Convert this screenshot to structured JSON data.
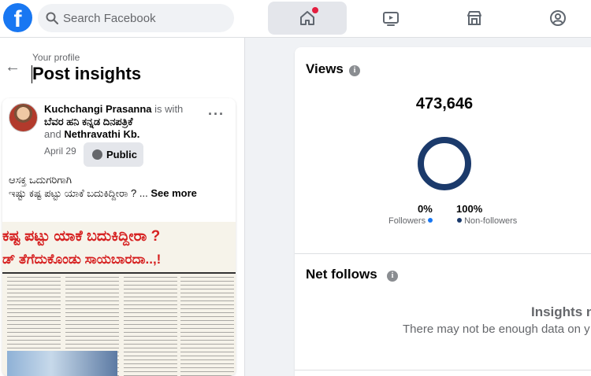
{
  "topbar": {
    "logo_letter": "f",
    "search": {
      "placeholder": "Search Facebook"
    }
  },
  "nav": {
    "tabs": [
      {
        "name": "home",
        "active": true,
        "has_notification": true
      },
      {
        "name": "watch",
        "active": false
      },
      {
        "name": "marketplace",
        "active": false
      },
      {
        "name": "groups",
        "active": false
      }
    ]
  },
  "left": {
    "subtitle": "Your profile",
    "title": "Post insights",
    "post": {
      "author": "Kuchchangi Prasanna",
      "with_text": "is with",
      "tagged1": "ಬೆವರ ಹನಿ ಕನ್ನಡ ದಿನಪತ್ರಿಕೆ",
      "and_text": "and",
      "tagged2": "Nethravathi Kb.",
      "date": "April 29",
      "audience": "Public",
      "line1": "ಆಸಕ್ತ ಒದುಗರಿಗಾಗಿ",
      "line2": "ಇಷ್ಟು ಕಷ್ಟ ಪಟ್ಟು ಯಾಕೆ ಬದುಕಿದ್ದೀರಾ ? ...",
      "see_more": "See more",
      "image_headline1": "ಕಷ್ಟ ಪಟ್ಟು ಯಾಕೆ ಬದುಕಿದ್ದೀರಾ ?",
      "image_headline2": "ಡ್ ತೆಗೆದುಕೊಂಡು ಸಾಯಬಾರದಾ..,!"
    }
  },
  "right": {
    "views": {
      "title": "Views",
      "count": "473,646",
      "followers_pct": "0%",
      "nonfollowers_pct": "100%",
      "followers_label": "Followers",
      "nonfollowers_label": "Non-followers",
      "followers_color": "#1877f2",
      "nonfollowers_color": "#1b3a6b"
    },
    "net_follows": {
      "title": "Net follows",
      "empty_title": "Insights n",
      "empty_text": "There may not be enough data on y"
    }
  }
}
